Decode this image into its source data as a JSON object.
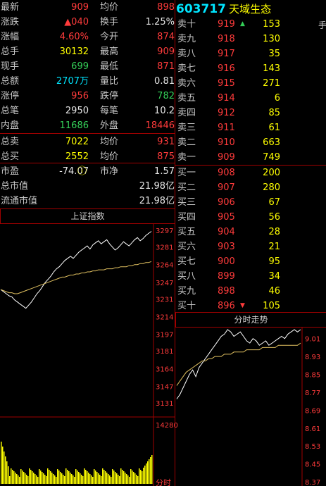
{
  "quote": {
    "code": "603717",
    "name": "天域生态",
    "rows_left": [
      {
        "label": "最新",
        "value": "909",
        "value_color": "red"
      },
      {
        "label": "涨跌",
        "value": "▲040",
        "value_color": "red"
      },
      {
        "label": "涨幅",
        "value": "4.60%",
        "value_color": "red"
      },
      {
        "label": "总手",
        "value": "30132",
        "value_color": "yellow"
      },
      {
        "label": "现手",
        "value": "699",
        "value_color": "green"
      },
      {
        "label": "总额",
        "value": "2707万",
        "value_color": "cyan"
      },
      {
        "label": "涨停",
        "value": "956",
        "value_color": "red"
      },
      {
        "label": "总笔",
        "value": "2950",
        "value_color": "white"
      },
      {
        "label": "内盘",
        "value": "11686",
        "value_color": "green"
      },
      {
        "label": "总卖",
        "value": "7022",
        "value_color": "yellow"
      },
      {
        "label": "总买",
        "value": "2552",
        "value_color": "yellow"
      },
      {
        "label": "市盈",
        "value": "-74.07",
        "value_color": "white",
        "value_suffix": "ⓘ"
      }
    ],
    "rows_right": [
      {
        "label": "均价",
        "value": "898",
        "value_color": "red"
      },
      {
        "label": "换手",
        "value": "1.25%",
        "value_color": "white"
      },
      {
        "label": "今开",
        "value": "874",
        "value_color": "red"
      },
      {
        "label": "最高",
        "value": "909",
        "value_color": "red"
      },
      {
        "label": "最低",
        "value": "871",
        "value_color": "red"
      },
      {
        "label": "量比",
        "value": "0.81",
        "value_color": "white"
      },
      {
        "label": "跌停",
        "value": "782",
        "value_color": "green"
      },
      {
        "label": "每笔",
        "value": "10.2",
        "value_color": "white"
      },
      {
        "label": "外盘",
        "value": "18446",
        "value_color": "red"
      },
      {
        "label": "均价",
        "value": "931",
        "value_color": "red"
      },
      {
        "label": "均价",
        "value": "875",
        "value_color": "red"
      },
      {
        "label": "市净",
        "value": "1.57",
        "value_color": "white"
      }
    ],
    "market_value": {
      "label": "总市值",
      "value": "21.98亿"
    },
    "float_value": {
      "label": "流通市值",
      "value": "21.98亿"
    }
  },
  "order_book": {
    "unit_label": "手",
    "asks": [
      {
        "label": "卖十",
        "price": "919",
        "volume": "153",
        "marker": "up"
      },
      {
        "label": "卖九",
        "price": "918",
        "volume": "130"
      },
      {
        "label": "卖八",
        "price": "917",
        "volume": "35"
      },
      {
        "label": "卖七",
        "price": "916",
        "volume": "143"
      },
      {
        "label": "卖六",
        "price": "915",
        "volume": "271"
      },
      {
        "label": "卖五",
        "price": "914",
        "volume": "6"
      },
      {
        "label": "卖四",
        "price": "912",
        "volume": "85"
      },
      {
        "label": "卖三",
        "price": "911",
        "volume": "61"
      },
      {
        "label": "卖二",
        "price": "910",
        "volume": "663"
      },
      {
        "label": "卖一",
        "price": "909",
        "volume": "749"
      }
    ],
    "bids": [
      {
        "label": "买一",
        "price": "908",
        "volume": "200"
      },
      {
        "label": "买二",
        "price": "907",
        "volume": "280"
      },
      {
        "label": "买三",
        "price": "906",
        "volume": "67"
      },
      {
        "label": "买四",
        "price": "905",
        "volume": "56"
      },
      {
        "label": "买五",
        "price": "904",
        "volume": "28"
      },
      {
        "label": "买六",
        "price": "903",
        "volume": "21"
      },
      {
        "label": "买七",
        "price": "900",
        "volume": "95"
      },
      {
        "label": "买八",
        "price": "899",
        "volume": "34"
      },
      {
        "label": "买九",
        "price": "898",
        "volume": "46"
      },
      {
        "label": "买十",
        "price": "896",
        "volume": "105",
        "marker": "down"
      }
    ]
  },
  "index_panel": {
    "title": "上证指数",
    "y_ticks": [
      "3297",
      "3281",
      "3264",
      "3247",
      "3231",
      "3214",
      "3197",
      "3181",
      "3164",
      "3147",
      "3131"
    ],
    "volume_tick": "14280",
    "x_label": "分时"
  },
  "intraday_panel": {
    "title": "分时走势",
    "y_ticks": [
      "9.01",
      "8.93",
      "8.85",
      "8.77",
      "8.69",
      "8.61",
      "8.53",
      "8.45",
      "8.37"
    ]
  },
  "chart_data": [
    {
      "type": "line",
      "title": "上证指数",
      "ylim": [
        3131,
        3297
      ],
      "series": [
        {
          "values": [
            3240,
            3238,
            3236,
            3234,
            3233,
            3230,
            3228,
            3226,
            3224,
            3222,
            3225,
            3228,
            3232,
            3236,
            3239,
            3243,
            3247,
            3250,
            3253,
            3257,
            3260,
            3262,
            3265,
            3268,
            3270,
            3272,
            3270,
            3273,
            3276,
            3278,
            3280,
            3282,
            3279,
            3283,
            3285,
            3287,
            3284,
            3286,
            3288,
            3284,
            3281,
            3278,
            3280,
            3283,
            3286,
            3284,
            3282,
            3285,
            3288,
            3290,
            3287,
            3289,
            3292,
            3294,
            3296
          ]
        },
        {
          "values": [
            3240,
            3239,
            3238,
            3237,
            3237,
            3236,
            3236,
            3237,
            3238,
            3239,
            3240,
            3241,
            3242,
            3243,
            3244,
            3245,
            3246,
            3247,
            3248,
            3249,
            3250,
            3251,
            3252,
            3252,
            3253,
            3254,
            3254,
            3255,
            3255,
            3256,
            3256,
            3257,
            3257,
            3258,
            3258,
            3259,
            3259,
            3259,
            3260,
            3260,
            3260,
            3261,
            3261,
            3262,
            3262,
            3262,
            3263,
            3263,
            3264,
            3264,
            3265,
            3265,
            3266,
            3266,
            3267
          ]
        }
      ]
    },
    {
      "type": "line",
      "title": "分时走势",
      "ylim": [
        8.37,
        9.05
      ],
      "series": [
        {
          "values": [
            8.74,
            8.76,
            8.79,
            8.82,
            8.85,
            8.87,
            8.84,
            8.88,
            8.9,
            8.92,
            8.94,
            8.96,
            8.98,
            9.0,
            9.02,
            9.03,
            9.05,
            9.04,
            9.02,
            9.03,
            9.04,
            9.02,
            9.0,
            8.99,
            9.01,
            9.0,
            8.98,
            8.99,
            9.0,
            8.98,
            8.99,
            9.0,
            9.01,
            9.02,
            9.01,
            9.03,
            9.04,
            9.05,
            9.04,
            9.05
          ]
        },
        {
          "values": [
            8.8,
            8.82,
            8.84,
            8.86,
            8.87,
            8.88,
            8.89,
            8.9,
            8.91,
            8.91,
            8.92,
            8.92,
            8.93,
            8.93,
            8.93,
            8.94,
            8.94,
            8.94,
            8.95,
            8.95,
            8.95,
            8.95,
            8.96,
            8.96,
            8.96,
            8.96,
            8.96,
            8.97,
            8.97,
            8.97,
            8.97,
            8.97,
            8.98,
            8.98,
            8.98,
            8.98,
            8.98,
            8.98,
            8.98,
            8.99
          ]
        }
      ]
    }
  ],
  "colors": {
    "up": "#ff3b3b",
    "down": "#34d058",
    "bg": "#000000",
    "grid": "#a00000"
  }
}
